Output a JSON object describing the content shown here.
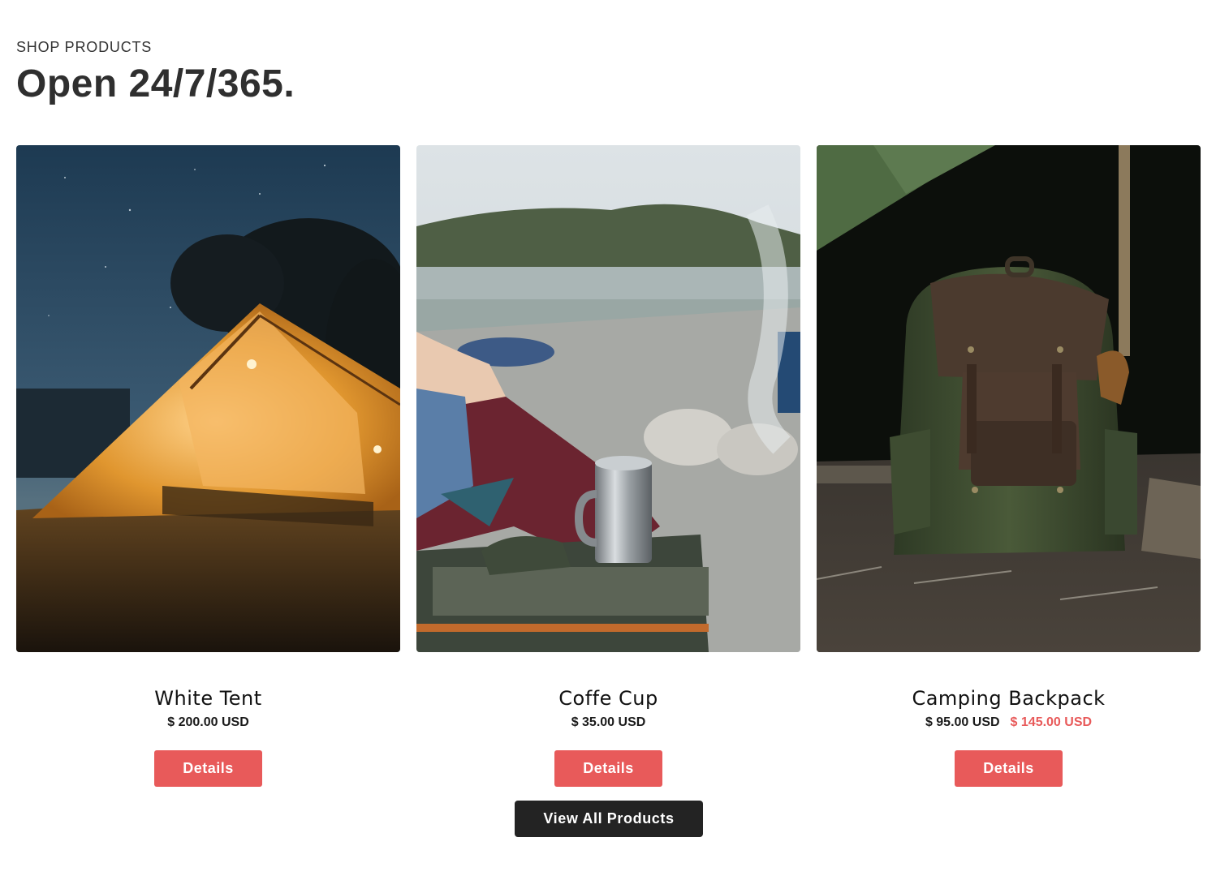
{
  "header": {
    "eyebrow": "SHOP PRODUCTS",
    "title": "Open 24/7/365."
  },
  "products": [
    {
      "name": "White Tent",
      "price": "$ 200.00 USD",
      "compare_price": "",
      "details_label": "Details",
      "image": "tent-at-night-photo"
    },
    {
      "name": "Coffe Cup",
      "price": "$ 35.00 USD",
      "compare_price": "",
      "details_label": "Details",
      "image": "steel-mug-on-cooler-photo"
    },
    {
      "name": "Camping Backpack",
      "price": "$ 95.00 USD",
      "compare_price": "$ 145.00 USD",
      "details_label": "Details",
      "image": "leather-backpack-photo"
    }
  ],
  "footer": {
    "view_all_label": "View All Products"
  },
  "colors": {
    "accent": "#e85a5a",
    "dark_button": "#232323",
    "text": "#2f2f2f"
  }
}
